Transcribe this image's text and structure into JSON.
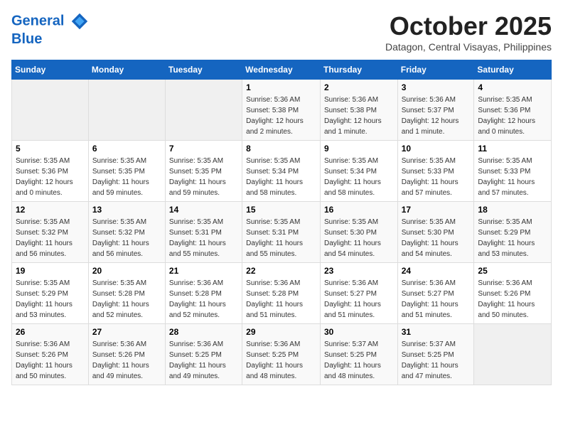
{
  "header": {
    "logo_line1": "General",
    "logo_line2": "Blue",
    "month": "October 2025",
    "location": "Datagon, Central Visayas, Philippines"
  },
  "days_of_week": [
    "Sunday",
    "Monday",
    "Tuesday",
    "Wednesday",
    "Thursday",
    "Friday",
    "Saturday"
  ],
  "weeks": [
    [
      {
        "day": "",
        "info": ""
      },
      {
        "day": "",
        "info": ""
      },
      {
        "day": "",
        "info": ""
      },
      {
        "day": "1",
        "info": "Sunrise: 5:36 AM\nSunset: 5:38 PM\nDaylight: 12 hours\nand 2 minutes."
      },
      {
        "day": "2",
        "info": "Sunrise: 5:36 AM\nSunset: 5:38 PM\nDaylight: 12 hours\nand 1 minute."
      },
      {
        "day": "3",
        "info": "Sunrise: 5:36 AM\nSunset: 5:37 PM\nDaylight: 12 hours\nand 1 minute."
      },
      {
        "day": "4",
        "info": "Sunrise: 5:35 AM\nSunset: 5:36 PM\nDaylight: 12 hours\nand 0 minutes."
      }
    ],
    [
      {
        "day": "5",
        "info": "Sunrise: 5:35 AM\nSunset: 5:36 PM\nDaylight: 12 hours\nand 0 minutes."
      },
      {
        "day": "6",
        "info": "Sunrise: 5:35 AM\nSunset: 5:35 PM\nDaylight: 11 hours\nand 59 minutes."
      },
      {
        "day": "7",
        "info": "Sunrise: 5:35 AM\nSunset: 5:35 PM\nDaylight: 11 hours\nand 59 minutes."
      },
      {
        "day": "8",
        "info": "Sunrise: 5:35 AM\nSunset: 5:34 PM\nDaylight: 11 hours\nand 58 minutes."
      },
      {
        "day": "9",
        "info": "Sunrise: 5:35 AM\nSunset: 5:34 PM\nDaylight: 11 hours\nand 58 minutes."
      },
      {
        "day": "10",
        "info": "Sunrise: 5:35 AM\nSunset: 5:33 PM\nDaylight: 11 hours\nand 57 minutes."
      },
      {
        "day": "11",
        "info": "Sunrise: 5:35 AM\nSunset: 5:33 PM\nDaylight: 11 hours\nand 57 minutes."
      }
    ],
    [
      {
        "day": "12",
        "info": "Sunrise: 5:35 AM\nSunset: 5:32 PM\nDaylight: 11 hours\nand 56 minutes."
      },
      {
        "day": "13",
        "info": "Sunrise: 5:35 AM\nSunset: 5:32 PM\nDaylight: 11 hours\nand 56 minutes."
      },
      {
        "day": "14",
        "info": "Sunrise: 5:35 AM\nSunset: 5:31 PM\nDaylight: 11 hours\nand 55 minutes."
      },
      {
        "day": "15",
        "info": "Sunrise: 5:35 AM\nSunset: 5:31 PM\nDaylight: 11 hours\nand 55 minutes."
      },
      {
        "day": "16",
        "info": "Sunrise: 5:35 AM\nSunset: 5:30 PM\nDaylight: 11 hours\nand 54 minutes."
      },
      {
        "day": "17",
        "info": "Sunrise: 5:35 AM\nSunset: 5:30 PM\nDaylight: 11 hours\nand 54 minutes."
      },
      {
        "day": "18",
        "info": "Sunrise: 5:35 AM\nSunset: 5:29 PM\nDaylight: 11 hours\nand 53 minutes."
      }
    ],
    [
      {
        "day": "19",
        "info": "Sunrise: 5:35 AM\nSunset: 5:29 PM\nDaylight: 11 hours\nand 53 minutes."
      },
      {
        "day": "20",
        "info": "Sunrise: 5:35 AM\nSunset: 5:28 PM\nDaylight: 11 hours\nand 52 minutes."
      },
      {
        "day": "21",
        "info": "Sunrise: 5:36 AM\nSunset: 5:28 PM\nDaylight: 11 hours\nand 52 minutes."
      },
      {
        "day": "22",
        "info": "Sunrise: 5:36 AM\nSunset: 5:28 PM\nDaylight: 11 hours\nand 51 minutes."
      },
      {
        "day": "23",
        "info": "Sunrise: 5:36 AM\nSunset: 5:27 PM\nDaylight: 11 hours\nand 51 minutes."
      },
      {
        "day": "24",
        "info": "Sunrise: 5:36 AM\nSunset: 5:27 PM\nDaylight: 11 hours\nand 51 minutes."
      },
      {
        "day": "25",
        "info": "Sunrise: 5:36 AM\nSunset: 5:26 PM\nDaylight: 11 hours\nand 50 minutes."
      }
    ],
    [
      {
        "day": "26",
        "info": "Sunrise: 5:36 AM\nSunset: 5:26 PM\nDaylight: 11 hours\nand 50 minutes."
      },
      {
        "day": "27",
        "info": "Sunrise: 5:36 AM\nSunset: 5:26 PM\nDaylight: 11 hours\nand 49 minutes."
      },
      {
        "day": "28",
        "info": "Sunrise: 5:36 AM\nSunset: 5:25 PM\nDaylight: 11 hours\nand 49 minutes."
      },
      {
        "day": "29",
        "info": "Sunrise: 5:36 AM\nSunset: 5:25 PM\nDaylight: 11 hours\nand 48 minutes."
      },
      {
        "day": "30",
        "info": "Sunrise: 5:37 AM\nSunset: 5:25 PM\nDaylight: 11 hours\nand 48 minutes."
      },
      {
        "day": "31",
        "info": "Sunrise: 5:37 AM\nSunset: 5:25 PM\nDaylight: 11 hours\nand 47 minutes."
      },
      {
        "day": "",
        "info": ""
      }
    ]
  ]
}
